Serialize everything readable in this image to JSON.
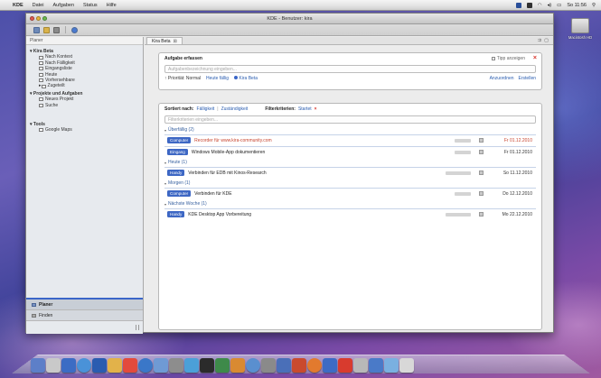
{
  "menubar": {
    "apple": "",
    "app_name": "KDE",
    "items": [
      "Datei",
      "Aufgaben",
      "Status",
      "Hilfe"
    ],
    "clock": "So 11:56"
  },
  "window": {
    "title": "KDE - Benutzer: kira"
  },
  "sidebar": {
    "header": "Planer",
    "tree": [
      {
        "label": "Kira Beta",
        "level": 0,
        "group": true
      },
      {
        "label": "Nach Kontext",
        "level": 1
      },
      {
        "label": "Nach Fälligkeit",
        "level": 1
      },
      {
        "label": "Eingangsliste",
        "level": 1
      },
      {
        "label": "Heute",
        "level": 1
      },
      {
        "label": "Vorhersehbare",
        "level": 1
      },
      {
        "label": "Zugeteilt",
        "level": 1
      },
      {
        "label": "Projekte und Aufgaben",
        "level": 0,
        "group": true
      },
      {
        "label": "Neues Projekt",
        "level": 1
      },
      {
        "label": "Suche",
        "level": 1
      },
      {
        "label": "Tools",
        "level": 0,
        "group": true
      },
      {
        "label": "Google Maps",
        "level": 1
      }
    ],
    "bottom_tabs": [
      "Planer",
      "Finden"
    ]
  },
  "tab": {
    "label": "Kira Beta"
  },
  "create_panel": {
    "title": "Aufgabe erfassen",
    "checkbox_label": "Tipp anzeigen",
    "input_placeholder": "Aufgabenbezeichnung eingeben...",
    "options": [
      {
        "label": "Priorität: Normal",
        "link": false
      },
      {
        "label": "Heute fällig",
        "link": true
      },
      {
        "label": "Kira Beta",
        "link": true
      }
    ],
    "right_actions": [
      "Anzuordnen",
      "Erstellen"
    ]
  },
  "list_panel": {
    "sort_label": "Sortiert nach:",
    "sort_options": [
      "Fälligkeit",
      "Zuständigkeit"
    ],
    "filter_label": "Filterkriterien:",
    "filter_value": "Startet",
    "filter_placeholder": "Filterkriterien eingeben...",
    "groups": [
      {
        "title": "Überfällig (2)",
        "tasks": [
          {
            "category": "Computer",
            "text": "Recorder für www.kira-community.com",
            "due": "Fr 01.12.2010",
            "red": true
          },
          {
            "category": "Eingang",
            "text": "Windows Mobile-App dokumentieren",
            "due": "Fr 01.12.2010",
            "red": false
          }
        ]
      },
      {
        "title": "Heute (1)",
        "tasks": [
          {
            "category": "Handy",
            "text": "Verbinden für EDB mit Kinos-Research",
            "due": "So 11.12.2010",
            "red": false
          }
        ]
      },
      {
        "title": "Morgen (1)",
        "tasks": [
          {
            "category": "Computer",
            "text": "Verbinden für KDE",
            "due": "Do 12.12.2010",
            "red": false
          }
        ]
      },
      {
        "title": "Nächste Woche (1)",
        "tasks": [
          {
            "category": "Handy",
            "text": "KDE Desktop App Vorbereitung",
            "due": "Mo 22.12.2010",
            "red": false
          }
        ]
      }
    ]
  },
  "desktop": {
    "hd_label": "Macintosh HD"
  },
  "colors": {
    "accent": "#3d67c4",
    "close": "#d8332b",
    "link": "#2a5db0"
  }
}
